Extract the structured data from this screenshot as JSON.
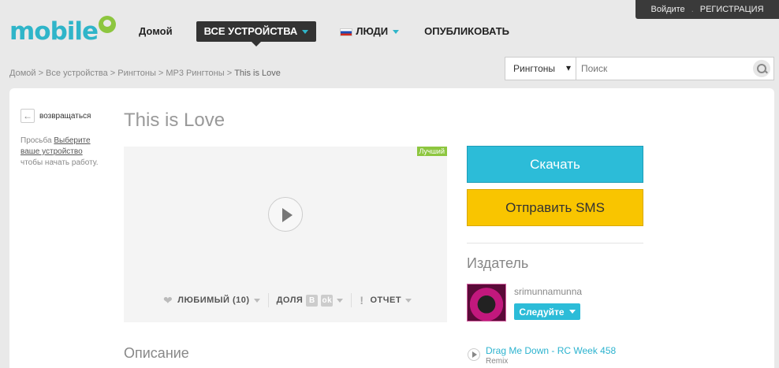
{
  "auth": {
    "login": "Войдите",
    "register": "РЕГИСТРАЦИЯ"
  },
  "logo": {
    "text": "mobile"
  },
  "nav": {
    "home": "Домой",
    "devices": "ВСЕ УСТРОЙСТВА",
    "people": "ЛЮДИ",
    "publish": "ОПУБЛИКОВАТЬ"
  },
  "breadcrumb": {
    "path": "Домой > Все устройства > Рингтоны > MP3 Рингтоны > ",
    "current": "This is Love"
  },
  "search": {
    "category": "Рингтоны",
    "placeholder": "Поиск"
  },
  "sidebar": {
    "back": "возвращаться",
    "hint_prefix": "Просьба ",
    "hint_link": "Выберите ваше устройство",
    "hint_suffix": " чтобы начать работу."
  },
  "ringtone": {
    "title": "This is Love",
    "badge": "Лучший",
    "favorites_label": "ЛЮБИМЫЙ",
    "favorites_count": "(10)",
    "share_label": "ДОЛЯ",
    "share_vk": "B",
    "share_ok": "ok",
    "report_label": "ОТЧЕТ"
  },
  "description": {
    "heading": "Описание"
  },
  "actions": {
    "download": "Скачать",
    "sms": "Отправить SMS"
  },
  "publisher": {
    "heading": "Издатель",
    "name": "srimunnamunna",
    "follow": "Следуйте"
  },
  "related": {
    "title": "Drag Me Down - RC Week 458",
    "subtitle": "Remix"
  },
  "colors": {
    "accent": "#2cbcd8",
    "sms": "#f9c500",
    "badge": "#8dc63f",
    "logo": "#2fb5c9"
  },
  "icons": {
    "play": "play-icon",
    "heart": "heart-icon",
    "search": "search-icon",
    "back": "arrow-left-icon",
    "report": "exclamation-icon"
  }
}
